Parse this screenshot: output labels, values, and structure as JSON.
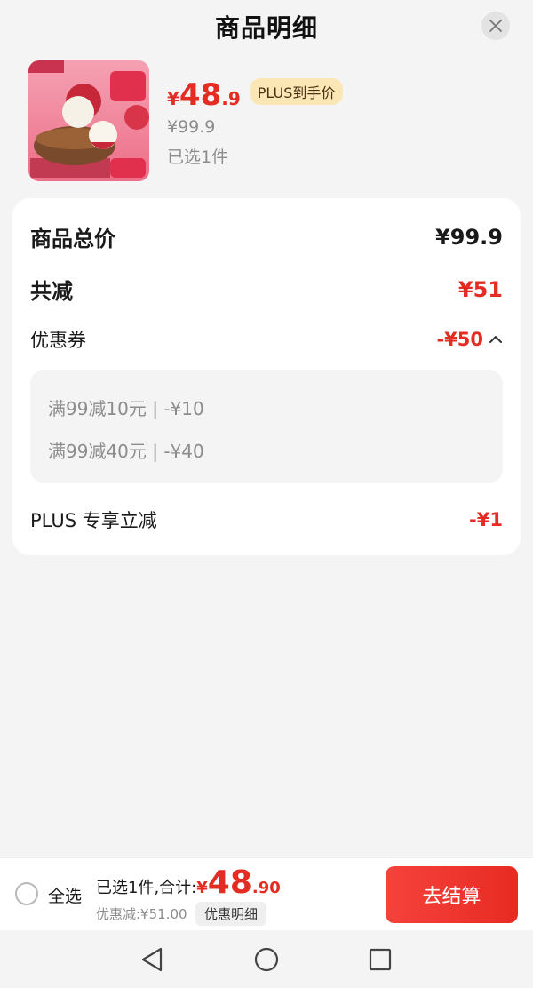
{
  "header": {
    "title": "商品明细",
    "close_icon": "close-icon"
  },
  "product": {
    "image_icon": "lychee-product-image",
    "price_symbol": "¥",
    "price_int": "48",
    "price_dec": ".9",
    "plus_tag": "PLUS到手价",
    "original_price": "¥99.9",
    "selected": "已选1件"
  },
  "summary": {
    "total_label": "商品总价",
    "total_value": "¥99.9",
    "reduce_label": "共减",
    "reduce_value": "¥51",
    "coupon_label": "优惠券",
    "coupon_value": "-¥50",
    "coupon_items": [
      "满99减10元 | -¥10",
      "满99减40元 | -¥40"
    ],
    "plus_label": "PLUS 专享立减",
    "plus_value": "-¥1"
  },
  "bottom_bar": {
    "select_all": "全选",
    "sum_prefix": "已选1件,合计:",
    "sum_symbol": "¥",
    "sum_int": "48",
    "sum_dec": ".90",
    "discount_text": "优惠减:¥51.00",
    "detail_button": "优惠明细",
    "checkout_button": "去结算"
  },
  "colors": {
    "accent_red": "#e42c23",
    "plus_tag_bg": "#fbe7b6",
    "page_bg": "#f4f4f4"
  }
}
